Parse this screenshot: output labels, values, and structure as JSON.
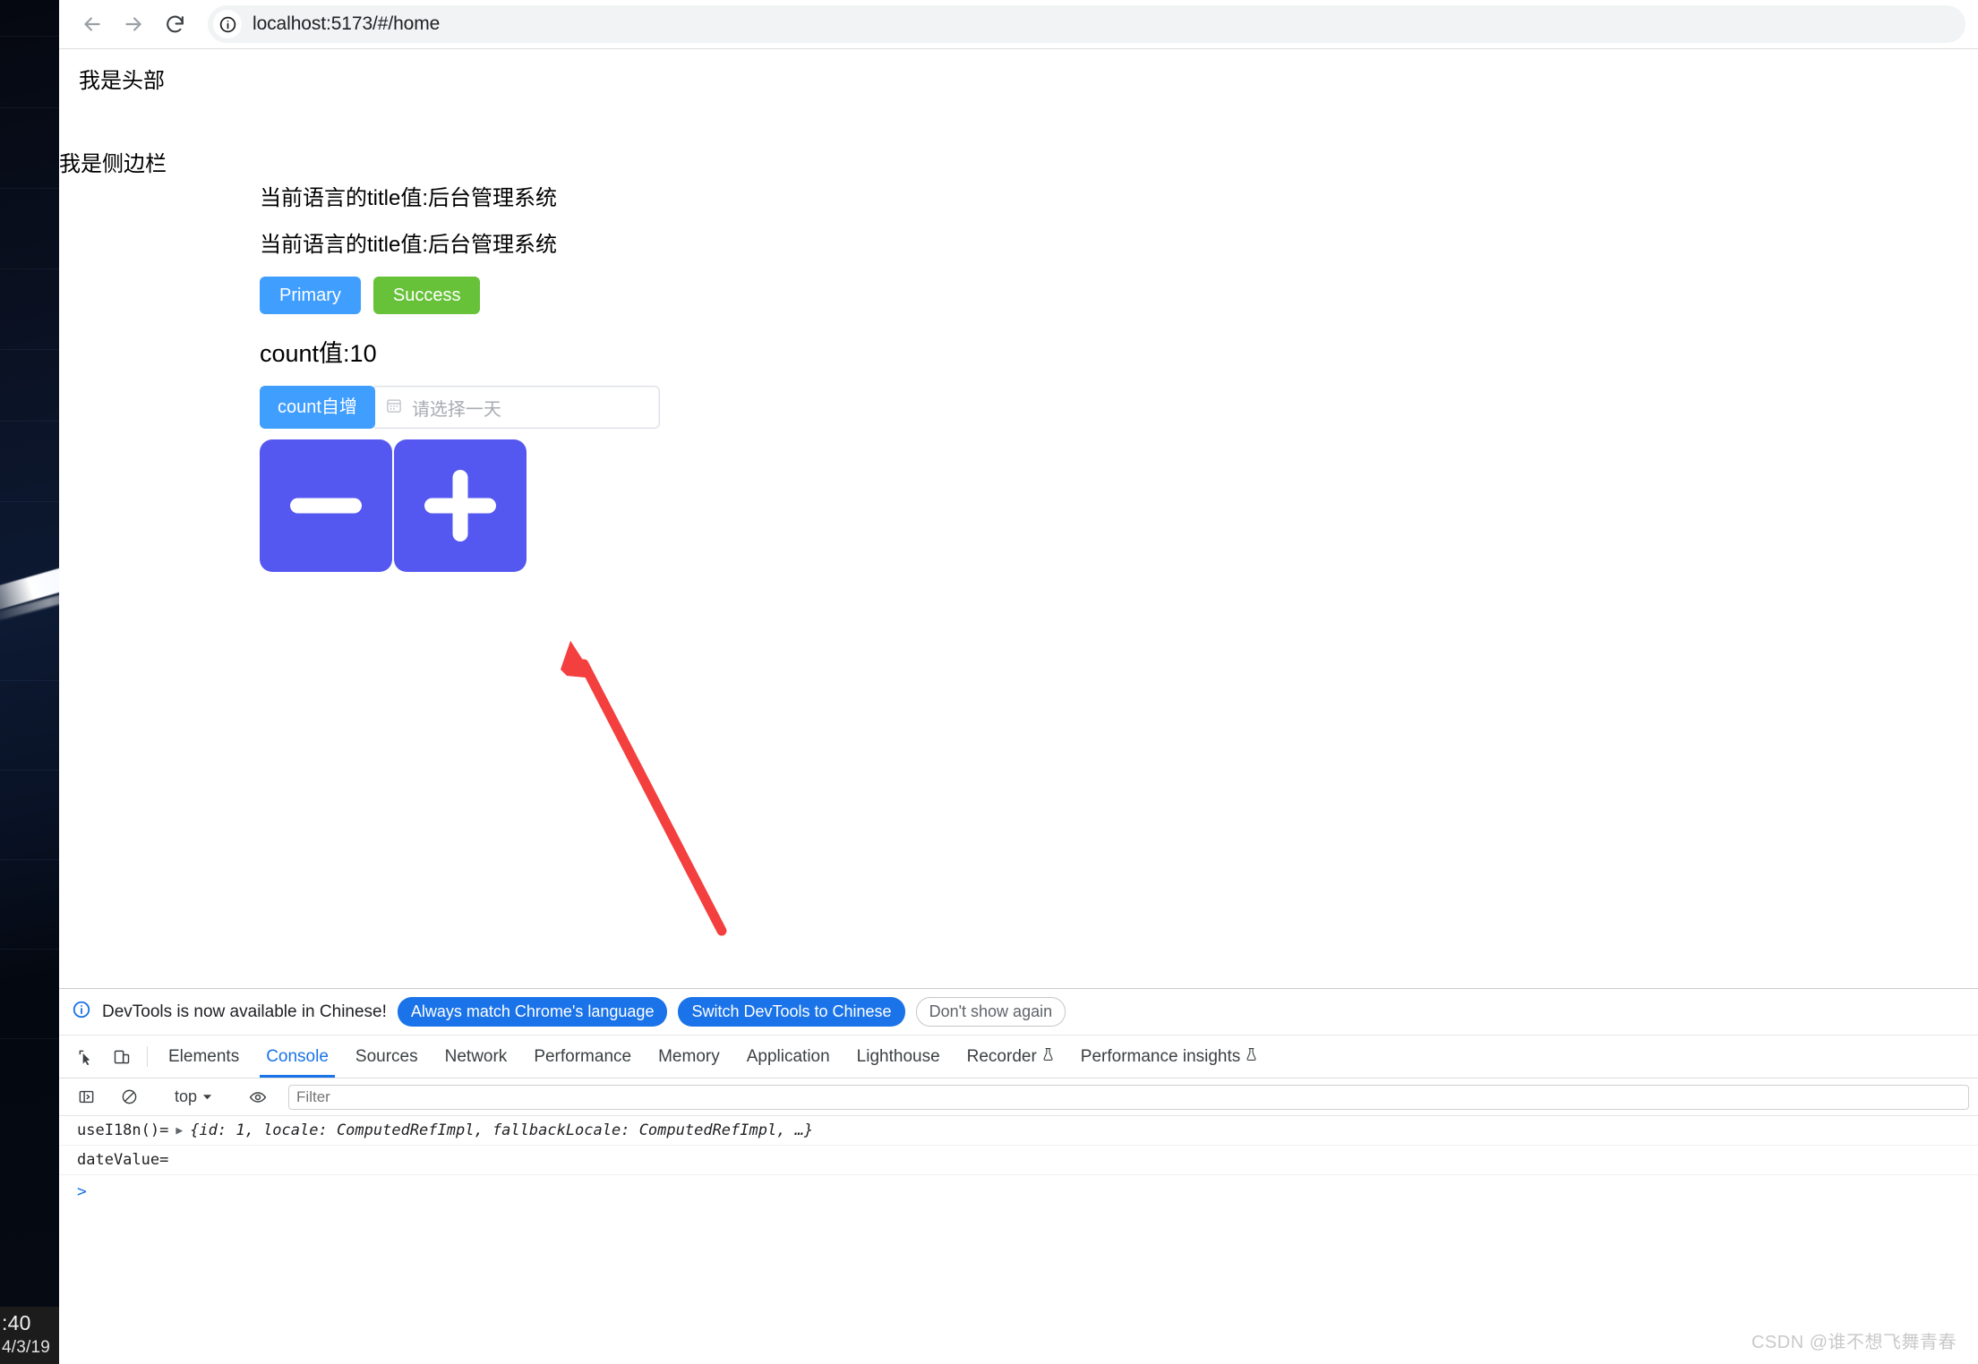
{
  "browser": {
    "back_icon": "back-arrow-icon",
    "forward_icon": "forward-arrow-icon",
    "reload_icon": "reload-icon",
    "site_info_icon": "info-circle-icon",
    "url": "localhost:5173/#/home"
  },
  "desktop": {
    "clock_time": ":40",
    "clock_date": "4/3/19"
  },
  "page": {
    "header_text": "我是头部",
    "sidebar_text": "我是侧边栏",
    "title_line_1": "当前语言的title值:后台管理系统",
    "title_line_2": "当前语言的title值:后台管理系统",
    "buttons": {
      "primary_label": "Primary",
      "success_label": "Success",
      "primary_color": "#409eff",
      "success_color": "#67c23a"
    },
    "count_label": "count值:10",
    "count_increment_label": "count自增",
    "date_picker": {
      "placeholder": "请选择一天",
      "value": "",
      "icon": "calendar-icon"
    },
    "stepper": {
      "decrement_icon": "minus-icon",
      "increment_icon": "plus-icon",
      "color": "#5558f0"
    },
    "annotation": {
      "arrow_icon": "red-arrow-annotation",
      "color": "#f43f3f"
    }
  },
  "devtools": {
    "notice": {
      "icon": "info-circle-icon",
      "message": "DevTools is now available in Chinese!",
      "btn_always_match": "Always match Chrome's language",
      "btn_switch": "Switch DevTools to Chinese",
      "btn_dismiss": "Don't show again"
    },
    "toolbar_icons": {
      "inspect": "inspect-element-icon",
      "device": "device-toolbar-icon"
    },
    "tabs": [
      {
        "label": "Elements",
        "active": false,
        "badge": ""
      },
      {
        "label": "Console",
        "active": true,
        "badge": ""
      },
      {
        "label": "Sources",
        "active": false,
        "badge": ""
      },
      {
        "label": "Network",
        "active": false,
        "badge": ""
      },
      {
        "label": "Performance",
        "active": false,
        "badge": ""
      },
      {
        "label": "Memory",
        "active": false,
        "badge": ""
      },
      {
        "label": "Application",
        "active": false,
        "badge": ""
      },
      {
        "label": "Lighthouse",
        "active": false,
        "badge": ""
      },
      {
        "label": "Recorder",
        "active": false,
        "badge": "flask-icon"
      },
      {
        "label": "Performance insights",
        "active": false,
        "badge": "flask-icon"
      }
    ],
    "console_toolbar": {
      "sidebar_icon": "console-sidebar-icon",
      "clear_icon": "clear-console-icon",
      "context": "top",
      "context_chevron": "chevron-down-icon",
      "eye_icon": "live-expression-eye-icon",
      "filter_placeholder": "Filter"
    },
    "console_logs": [
      {
        "label": "useI18n()=",
        "expander": "▶",
        "object": "{id: 1, locale: ComputedRefImpl, fallbackLocale: ComputedRefImpl, …}"
      },
      {
        "label": "dateValue=",
        "expander": "",
        "object": ""
      }
    ],
    "prompt_symbol": ">"
  },
  "watermark": "CSDN @谁不想飞舞青春"
}
